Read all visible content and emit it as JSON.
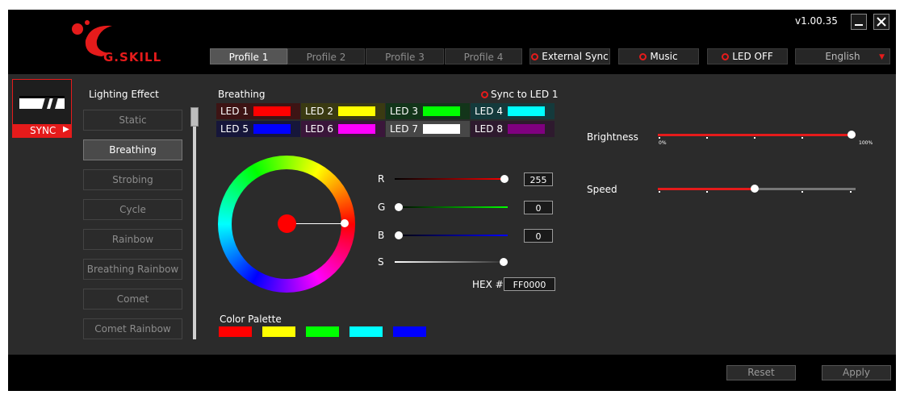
{
  "app": {
    "version": "v1.00.35",
    "logo_text": "G.SKILL"
  },
  "window_controls": {
    "minimize_icon": "minimize-icon",
    "close_icon": "close-icon"
  },
  "profiles": [
    {
      "label": "Profile 1",
      "active": true
    },
    {
      "label": "Profile 2",
      "active": false
    },
    {
      "label": "Profile 3",
      "active": false
    },
    {
      "label": "Profile 4",
      "active": false
    }
  ],
  "header_buttons": {
    "external_sync": "External Sync",
    "music": "Music",
    "led_off": "LED OFF"
  },
  "language": {
    "selected": "English"
  },
  "device": {
    "sync_label": "SYNC"
  },
  "lighting": {
    "heading": "Lighting Effect",
    "effects": [
      "Static",
      "Breathing",
      "Strobing",
      "Cycle",
      "Rainbow",
      "Breathing Rainbow",
      "Comet",
      "Comet Rainbow"
    ],
    "selected": "Breathing"
  },
  "effect_panel": {
    "title": "Breathing",
    "sync_to_led": "Sync to LED 1"
  },
  "leds": [
    {
      "label": "LED 1",
      "color": "#ff0000"
    },
    {
      "label": "LED 2",
      "color": "#ffff00"
    },
    {
      "label": "LED 3",
      "color": "#00ff00"
    },
    {
      "label": "LED 4",
      "color": "#00ffff"
    },
    {
      "label": "LED 5",
      "color": "#0000ff"
    },
    {
      "label": "LED 6",
      "color": "#ff00ff"
    },
    {
      "label": "LED 7",
      "color": "#ffffff"
    },
    {
      "label": "LED 8",
      "color": "#800080"
    }
  ],
  "color_picker": {
    "r_label": "R",
    "g_label": "G",
    "b_label": "B",
    "s_label": "S",
    "r": "255",
    "g": "0",
    "b": "0",
    "hex_label": "HEX #",
    "hex": "FF0000",
    "current_color": "#ff0000"
  },
  "palette": {
    "title": "Color Palette",
    "colors": [
      "#ff0000",
      "#ffff00",
      "#00ff00",
      "#00ffff",
      "#0000ff"
    ]
  },
  "brightness": {
    "label": "Brightness",
    "level_fraction": 1.0,
    "min_label": "0%",
    "max_label": "100%"
  },
  "speed": {
    "label": "Speed",
    "level_fraction": 0.5
  },
  "footer": {
    "reset": "Reset",
    "apply": "Apply"
  },
  "colors": {
    "accent": "#e51b1b",
    "panel": "#2b2b2b",
    "background": "#000000"
  }
}
